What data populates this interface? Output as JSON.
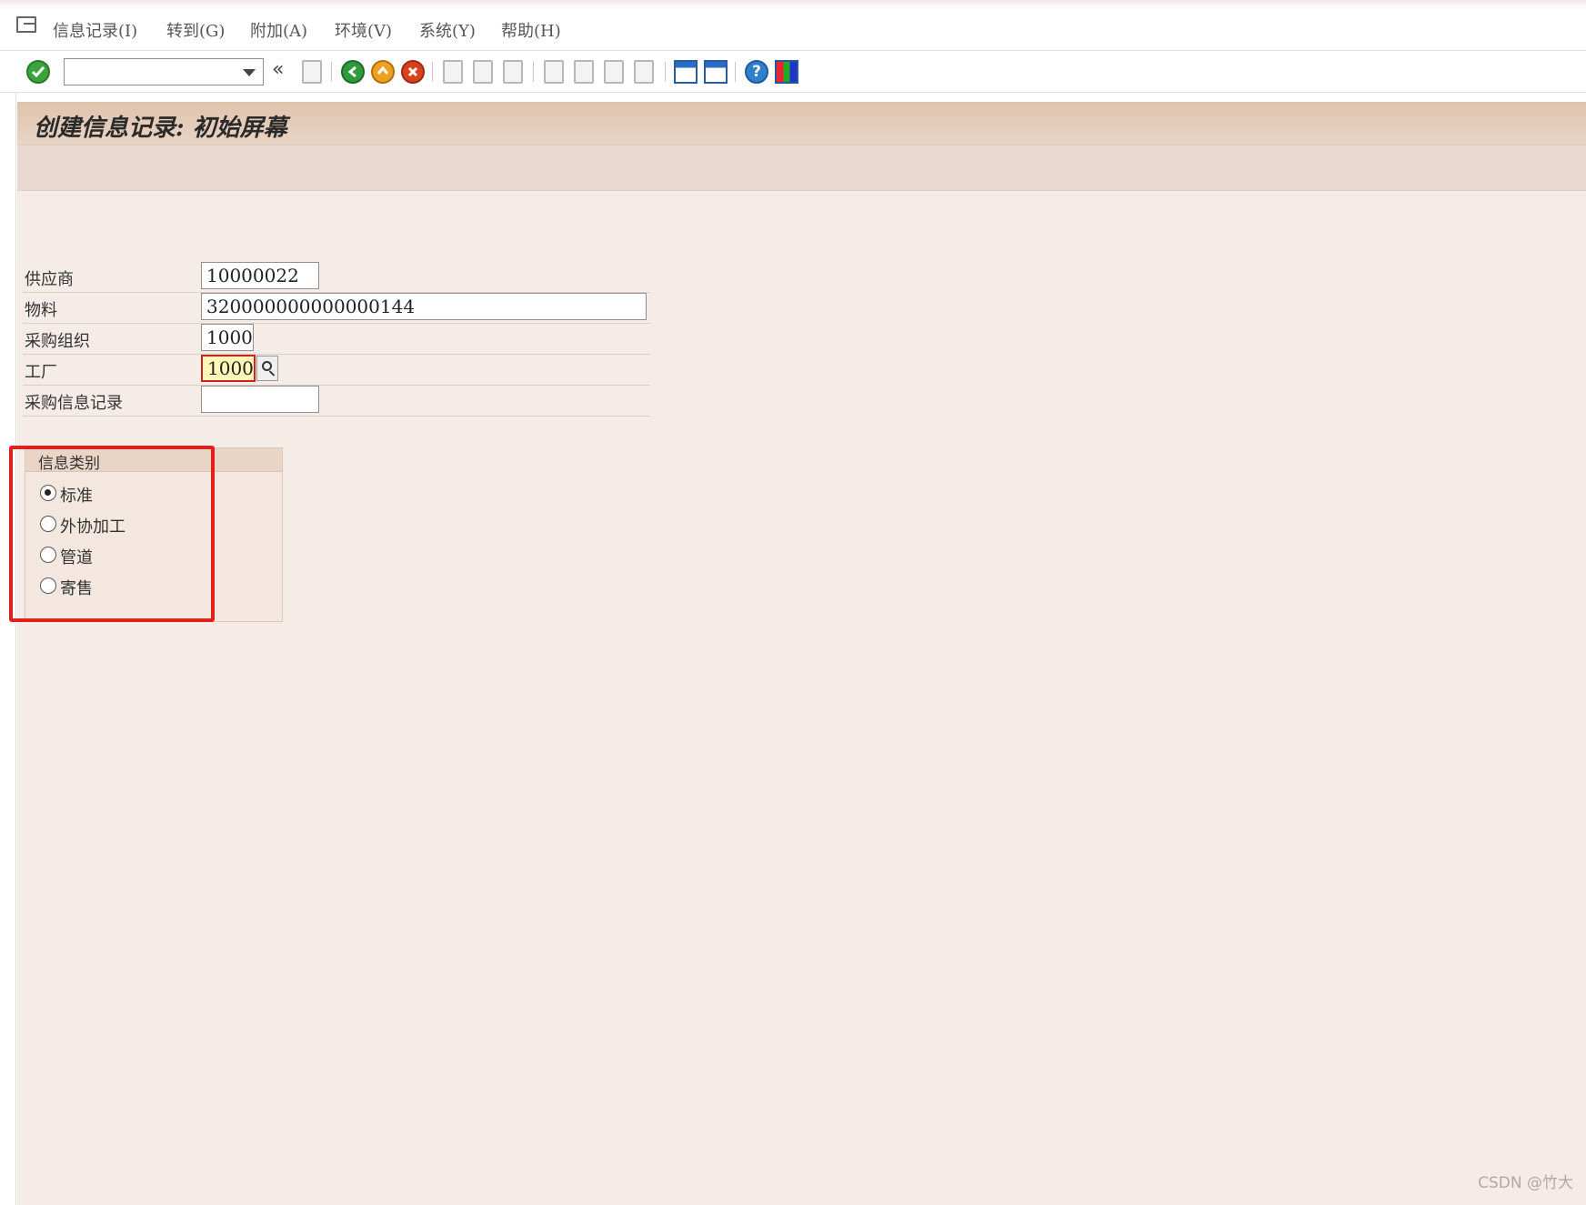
{
  "menubar": {
    "items": [
      "信息记录(I)",
      "转到(G)",
      "附加(A)",
      "环境(V)",
      "系统(Y)",
      "帮助(H)"
    ]
  },
  "toolbar": {
    "command_field_value": "",
    "back_arrow": "«",
    "icons": [
      "enter-icon",
      "save-icon",
      "back-icon",
      "exit-icon",
      "cancel-icon",
      "print-icon",
      "find-icon",
      "find-next-icon",
      "first-page-icon",
      "previous-page-icon",
      "next-page-icon",
      "last-page-icon",
      "create-session-icon",
      "shortcut-icon",
      "help-icon",
      "customize-layout-icon"
    ]
  },
  "screen": {
    "title": "创建信息记录: 初始屏幕"
  },
  "form": {
    "vendor_label": "供应商",
    "vendor_value": "10000022",
    "material_label": "物料",
    "material_value": "320000000000000144",
    "purch_org_label": "采购组织",
    "purch_org_value": "1000",
    "plant_label": "工厂",
    "plant_value": "1000",
    "info_record_label": "采购信息记录",
    "info_record_value": ""
  },
  "info_category": {
    "title": "信息类别",
    "options": [
      {
        "label": "标准",
        "selected": true
      },
      {
        "label": "外协加工",
        "selected": false
      },
      {
        "label": "管道",
        "selected": false
      },
      {
        "label": "寄售",
        "selected": false
      }
    ]
  },
  "colors": {
    "content_bg": "#f5ece8",
    "title_bar": "#e0c4ad",
    "highlight": "#e0201b",
    "focused_field": "#fff7b8"
  },
  "watermark": "CSDN @竹大"
}
